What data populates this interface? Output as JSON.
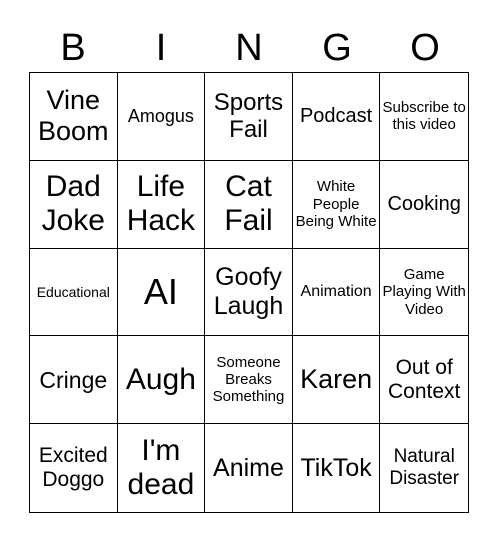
{
  "header": [
    "B",
    "I",
    "N",
    "G",
    "O"
  ],
  "cells": [
    "Vine Boom",
    "Amogus",
    "Sports Fail",
    "Podcast",
    "Subscribe to this video",
    "Dad Joke",
    "Life Hack",
    "Cat Fail",
    "White People Being White",
    "Cooking",
    "Educational",
    "AI",
    "Goofy Laugh",
    "Animation",
    "Game Playing With Video",
    "Cringe",
    "Augh",
    "Someone Breaks Something",
    "Karen",
    "Out of Context",
    "Excited Doggo",
    "I'm dead",
    "Anime",
    "TikTok",
    "Natural Disaster"
  ]
}
